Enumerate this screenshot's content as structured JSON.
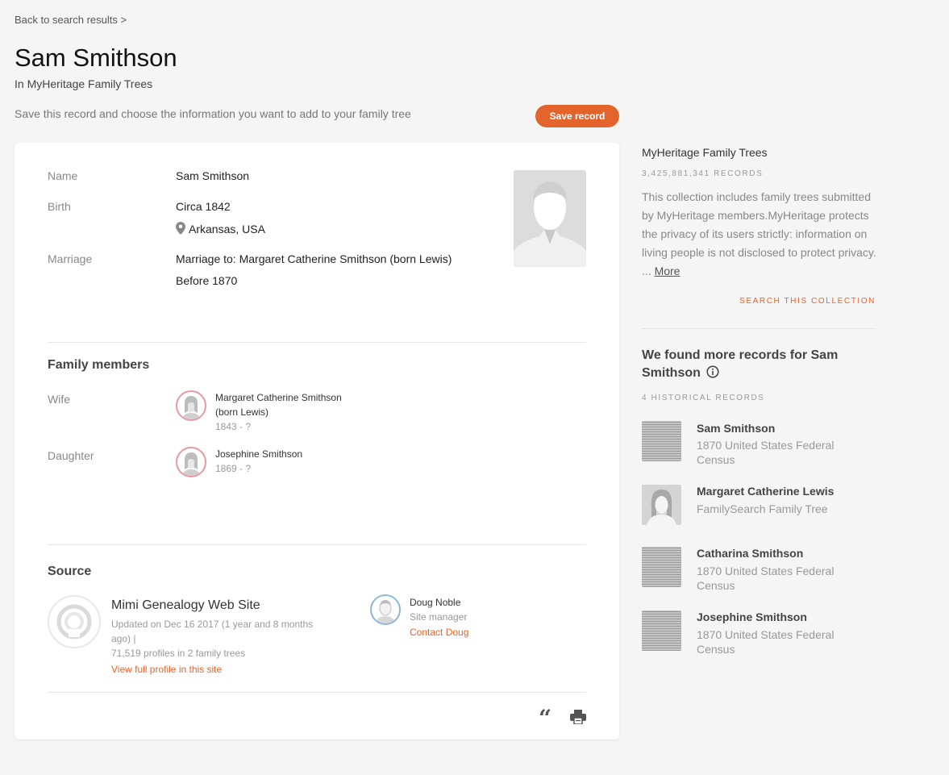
{
  "header": {
    "back_link": "Back to search results >",
    "title": "Sam Smithson",
    "subtitle": "In MyHeritage Family Trees",
    "save_hint": "Save this record and choose the information you want to add to your family tree",
    "save_button": "Save record"
  },
  "record": {
    "fields": {
      "name_label": "Name",
      "name_value": "Sam Smithson",
      "birth_label": "Birth",
      "birth_date": "Circa 1842",
      "birth_place": "Arkansas, USA",
      "marriage_label": "Marriage",
      "marriage_to": "Marriage to: Margaret Catherine Smithson (born Lewis)",
      "marriage_date": "Before 1870"
    },
    "family": {
      "title": "Family members",
      "members": [
        {
          "relation": "Wife",
          "name_line1": "Margaret Catherine Smithson",
          "name_line2": "(born Lewis)",
          "years": "1843 - ?"
        },
        {
          "relation": "Daughter",
          "name_line1": "Josephine Smithson",
          "name_line2": "",
          "years": "1869 - ?"
        }
      ]
    },
    "source": {
      "title": "Source",
      "site_name": "Mimi Genealogy Web Site",
      "updated_line1": "Updated on Dec 16 2017 (1 year and 8 months",
      "updated_line2": "ago)  |",
      "profiles": "71,519 profiles in 2 family trees",
      "view_link": "View full profile in this site",
      "manager_name": "Doug Noble",
      "manager_role": "Site manager",
      "contact_link": "Contact Doug"
    },
    "actions": {
      "cite_icon_glyph": "“",
      "cite_icon": "quote-icon",
      "print_icon": "printer-icon"
    }
  },
  "sidebar": {
    "collection_title": "MyHeritage Family Trees",
    "records_count": "3,425,881,341 RECORDS",
    "description": "This collection includes family trees submitted by MyHeritage members.MyHeritage protects the privacy of its users strictly: information on living people is not disclosed to protect privacy. ...",
    "more_link": "More",
    "search_collection": "SEARCH THIS COLLECTION",
    "found_title": "We found more records for Sam Smithson",
    "historical_count": "4 HISTORICAL RECORDS",
    "records": [
      {
        "name": "Sam Smithson",
        "desc_line1": "1870 United States Federal",
        "desc_line2": "Census",
        "thumb": "census"
      },
      {
        "name": "Margaret Catherine Lewis",
        "desc_line1": "FamilySearch Family Tree",
        "desc_line2": "",
        "thumb": "female-avatar"
      },
      {
        "name": "Catharina Smithson",
        "desc_line1": "1870 United States Federal",
        "desc_line2": "Census",
        "thumb": "census"
      },
      {
        "name": "Josephine Smithson",
        "desc_line1": "1870 United States Federal",
        "desc_line2": "Census",
        "thumb": "census"
      }
    ]
  },
  "colors": {
    "accent": "#e3642b",
    "female_ring": "#e89aa2",
    "male_ring": "#8fb8dd",
    "background": "#f5f5f5"
  }
}
